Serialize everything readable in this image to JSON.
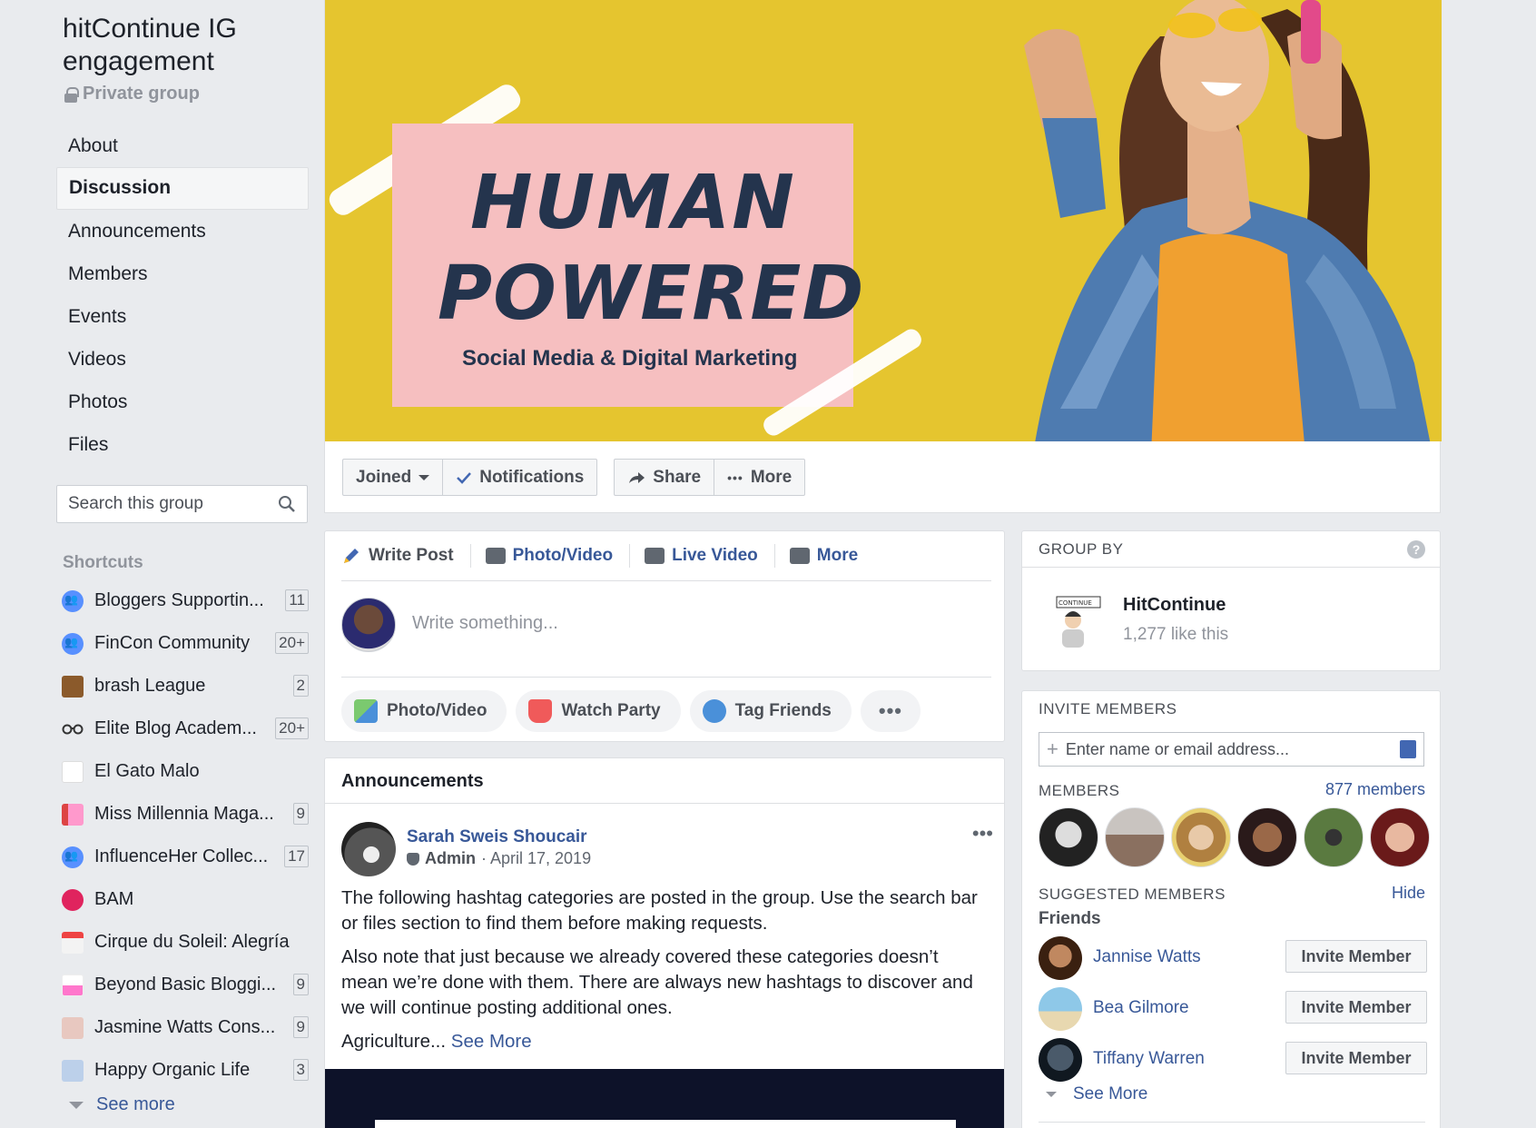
{
  "group": {
    "title": "hitContinue IG engagement",
    "privacy": "Private group"
  },
  "nav": [
    {
      "label": "About",
      "active": false
    },
    {
      "label": "Discussion",
      "active": true
    },
    {
      "label": "Announcements",
      "active": false
    },
    {
      "label": "Members",
      "active": false
    },
    {
      "label": "Events",
      "active": false
    },
    {
      "label": "Videos",
      "active": false
    },
    {
      "label": "Photos",
      "active": false
    },
    {
      "label": "Files",
      "active": false
    }
  ],
  "search": {
    "placeholder": "Search this group"
  },
  "shortcuts": {
    "heading": "Shortcuts",
    "items": [
      {
        "label": "Bloggers Supportin...",
        "badge": "11",
        "icon": "group-icon"
      },
      {
        "label": "FinCon Community",
        "badge": "20+",
        "icon": "group-icon"
      },
      {
        "label": "brash League",
        "badge": "2",
        "icon": "briefcase-icon"
      },
      {
        "label": "Elite Blog Academ...",
        "badge": "20+",
        "icon": "glasses-icon"
      },
      {
        "label": "El Gato Malo",
        "badge": "",
        "icon": "cat-logo-icon"
      },
      {
        "label": "Miss Millennia Maga...",
        "badge": "9",
        "icon": "magazine-icon"
      },
      {
        "label": "InfluenceHer Collec...",
        "badge": "17",
        "icon": "group-icon"
      },
      {
        "label": "BAM",
        "badge": "",
        "icon": "bam-icon"
      },
      {
        "label": "Cirque du Soleil: Alegría",
        "badge": "",
        "icon": "calendar-icon"
      },
      {
        "label": "Beyond Basic Bloggi...",
        "badge": "9",
        "icon": "blog-icon"
      },
      {
        "label": "Jasmine Watts Cons...",
        "badge": "9",
        "icon": "page-icon"
      },
      {
        "label": "Happy Organic Life",
        "badge": "3",
        "icon": "flag-icon"
      }
    ],
    "see_more": "See more"
  },
  "cover": {
    "line1": "HUMAN",
    "line2": "POWERED",
    "subtitle": "Social Media & Digital Marketing"
  },
  "actions": {
    "joined": "Joined",
    "notifications": "Notifications",
    "share": "Share",
    "more": "More"
  },
  "composer": {
    "tabs": [
      "Write Post",
      "Photo/Video",
      "Live Video",
      "More"
    ],
    "placeholder": "Write something...",
    "pills": [
      "Photo/Video",
      "Watch Party",
      "Tag Friends"
    ],
    "more_dots": "•••"
  },
  "announcements": {
    "heading": "Announcements",
    "post": {
      "author": "Sarah Sweis Shoucair",
      "role": "Admin",
      "date": "· April 17, 2019",
      "more_dots": "•••",
      "para1": "The following hashtag categories are posted in the group. Use the search bar or files section to find them before making requests.",
      "para2": "Also note that just because we already covered these categories doesn’t mean we’re done with them. There are always new hashtags to discover and we will continue posting additional ones.",
      "para3": "Agriculture...",
      "see_more": "See More"
    }
  },
  "group_by": {
    "heading": "GROUP BY",
    "help": "?",
    "name": "HitContinue",
    "likes": "1,277 like this",
    "logo_text": "CONTINUE"
  },
  "invite": {
    "heading": "INVITE MEMBERS",
    "placeholder": "Enter name or email address..."
  },
  "members": {
    "heading": "MEMBERS",
    "count": "877 members"
  },
  "suggested": {
    "heading": "SUGGESTED MEMBERS",
    "hide": "Hide",
    "subheading": "Friends",
    "people": [
      {
        "name": "Jannise Watts",
        "button": "Invite Member"
      },
      {
        "name": "Bea Gilmore",
        "button": "Invite Member"
      },
      {
        "name": "Tiffany Warren",
        "button": "Invite Member"
      }
    ],
    "see_more": "See More"
  },
  "colors": {
    "link": "#385898",
    "cover_bg": "#e5c52f",
    "cover_box": "#f6bfc0",
    "cover_text": "#24344d"
  }
}
